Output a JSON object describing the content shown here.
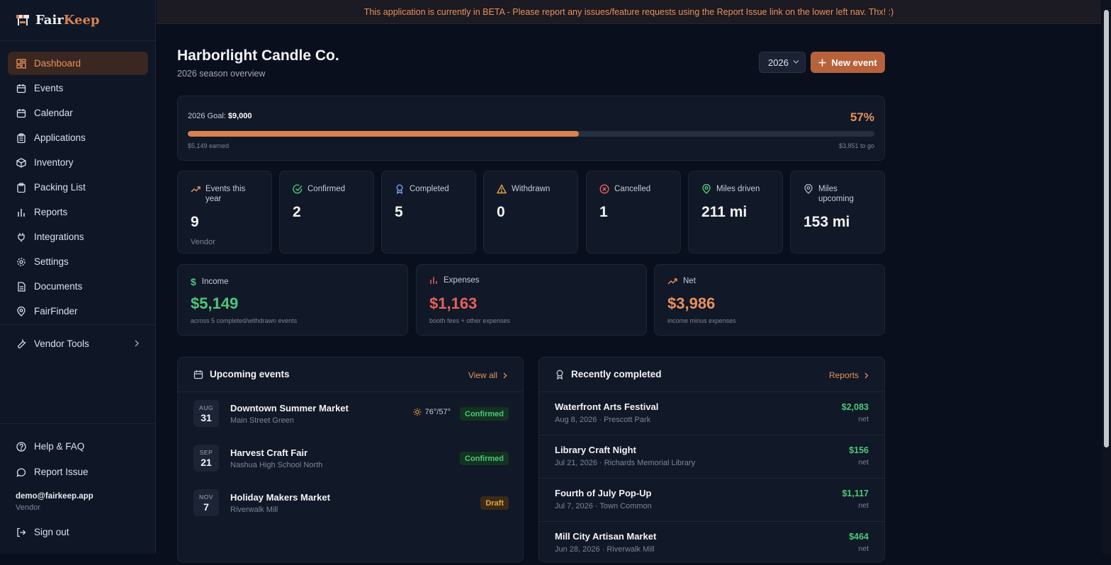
{
  "brand": {
    "name_part1": "Fair",
    "name_part2": "Keep"
  },
  "sidebar": {
    "items": [
      {
        "label": "Dashboard",
        "icon": "dashboard-icon"
      },
      {
        "label": "Events",
        "icon": "calendar-icon"
      },
      {
        "label": "Calendar",
        "icon": "calendar-icon"
      },
      {
        "label": "Applications",
        "icon": "clipboard-icon"
      },
      {
        "label": "Inventory",
        "icon": "box-icon"
      },
      {
        "label": "Packing List",
        "icon": "clipboard-icon"
      },
      {
        "label": "Reports",
        "icon": "bar-chart-icon"
      },
      {
        "label": "Integrations",
        "icon": "plug-icon"
      },
      {
        "label": "Settings",
        "icon": "gear-icon"
      },
      {
        "label": "Documents",
        "icon": "document-icon"
      },
      {
        "label": "FairFinder",
        "icon": "map-pin-icon"
      }
    ],
    "vendor_tools": "Vendor Tools",
    "help": "Help & FAQ",
    "report_issue": "Report Issue",
    "user_email": "demo@fairkeep.app",
    "user_role": "Vendor",
    "sign_out": "Sign out"
  },
  "banner": "This application is currently in BETA - Please report any issues/feature requests using the Report Issue link on the lower left nav. Thx! :)",
  "header": {
    "title": "Harborlight Candle Co.",
    "subtitle": "2026 season overview",
    "year": "2026",
    "new_event": "New event"
  },
  "goal": {
    "label": "2026 Goal:",
    "amount": "$9,000",
    "percent_text": "57%",
    "progress_fraction": 0.57,
    "earned": "$5,149 earned",
    "to_go": "$3,851 to go"
  },
  "stats": [
    {
      "label": "Events this year",
      "value": "9",
      "sub": "Vendor",
      "icon": "trending-up-icon",
      "color": "#e8915b"
    },
    {
      "label": "Confirmed",
      "value": "2",
      "sub": "",
      "icon": "check-circle-icon",
      "color": "#4cc87a"
    },
    {
      "label": "Completed",
      "value": "5",
      "sub": "",
      "icon": "award-icon",
      "color": "#7aa2f7"
    },
    {
      "label": "Withdrawn",
      "value": "0",
      "sub": "",
      "icon": "warning-icon",
      "color": "#e8a046"
    },
    {
      "label": "Cancelled",
      "value": "1",
      "sub": "",
      "icon": "x-circle-icon",
      "color": "#e5615c"
    },
    {
      "label": "Miles driven",
      "value": "211 mi",
      "sub": "",
      "icon": "map-pin-icon",
      "color": "#4cc87a"
    },
    {
      "label": "Miles upcoming",
      "value": "153 mi",
      "sub": "",
      "icon": "map-pin-icon",
      "color": "#a2a9b8"
    }
  ],
  "money": [
    {
      "label": "Income",
      "value": "$5,149",
      "sub": "across 5 completed/withdrawn events",
      "icon": "dollar-icon",
      "color": "#4cc87a"
    },
    {
      "label": "Expenses",
      "value": "$1,163",
      "sub": "booth fees + other expenses",
      "icon": "bar-chart-icon",
      "color": "#e5615c"
    },
    {
      "label": "Net",
      "value": "$3,986",
      "sub": "income minus expenses",
      "icon": "trending-up-icon",
      "color": "#e8915b"
    }
  ],
  "upcoming": {
    "title": "Upcoming events",
    "link": "View all",
    "events": [
      {
        "month": "AUG",
        "day": "31",
        "name": "Downtown Summer Market",
        "location": "Main Street Green",
        "weather": "76°/57°",
        "status": "Confirmed",
        "status_type": "green"
      },
      {
        "month": "SEP",
        "day": "21",
        "name": "Harvest Craft Fair",
        "location": "Nashua High School North",
        "weather": "",
        "status": "Confirmed",
        "status_type": "green"
      },
      {
        "month": "NOV",
        "day": "7",
        "name": "Holiday Makers Market",
        "location": "Riverwalk Mill",
        "weather": "",
        "status": "Draft",
        "status_type": "draft"
      }
    ]
  },
  "recent": {
    "title": "Recently completed",
    "link": "Reports",
    "events": [
      {
        "name": "Waterfront Arts Festival",
        "meta": "Aug 8, 2026 · Prescott Park",
        "amount": "$2,083",
        "net": "net"
      },
      {
        "name": "Library Craft Night",
        "meta": "Jul 21, 2026 · Richards Memorial Library",
        "amount": "$156",
        "net": "net"
      },
      {
        "name": "Fourth of July Pop-Up",
        "meta": "Jul 7, 2026 · Town Common",
        "amount": "$1,117",
        "net": "net"
      },
      {
        "name": "Mill City Artisan Market",
        "meta": "Jun 28, 2026 · Riverwalk Mill",
        "amount": "$464",
        "net": "net"
      }
    ]
  }
}
